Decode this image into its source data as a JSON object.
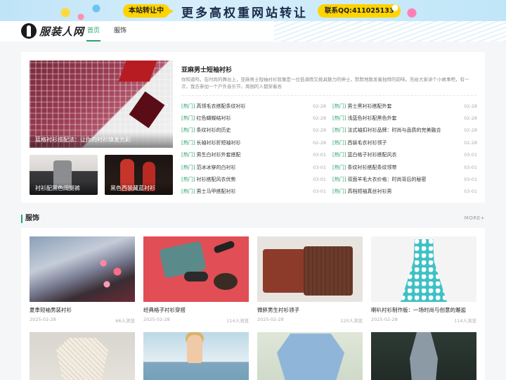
{
  "banner": {
    "tag": "本站转让中",
    "slogan": "更多高权重网站转让",
    "contact": "联系QQ:411025133"
  },
  "header": {
    "logo_text": "服装人网",
    "nav": [
      {
        "label": "首页",
        "active": true
      },
      {
        "label": "服饰",
        "active": false
      }
    ],
    "accent_color": "#2aa36b"
  },
  "feature": {
    "hero_caption": "蓝格衬衫搭配法：让你的衬衫焕发光彩",
    "thumbs": [
      {
        "caption": "衬衫配黑色阔腿裤"
      },
      {
        "caption": "黑色西装藏蓝衬衫"
      }
    ],
    "title": "亚麻男士短袖衬衫",
    "desc": "你知道吗，在时尚的舞台上，亚麻男士短袖衬衫就像是一位低调而又极具魅力的绅士，默默地散发着独特的韵味。先给大家讲个小故事吧，有一次，我去参加一个户外音乐节，周围的人都穿着各",
    "list_left": [
      {
        "tag": "[热门]",
        "title": "高领毛衣搭配条纹衬衫",
        "date": "02-28"
      },
      {
        "tag": "[热门]",
        "title": "红色蝴蝶结衬衫",
        "date": "02-28"
      },
      {
        "tag": "[热门]",
        "title": "条纹衬衫的历史",
        "date": "02-28"
      },
      {
        "tag": "[热门]",
        "title": "长袖衬衫折短袖衬衫",
        "date": "02-28"
      },
      {
        "tag": "[热门]",
        "title": "男生白衬衫外套搭配",
        "date": "03-01"
      },
      {
        "tag": "[热门]",
        "title": "范冰冰穿的白衬衫",
        "date": "03-01"
      },
      {
        "tag": "[热门]",
        "title": "衬衫搭配风衣优势",
        "date": "03-01"
      },
      {
        "tag": "[热门]",
        "title": "男士马甲搭配衬衫",
        "date": "03-01"
      }
    ],
    "list_right": [
      {
        "tag": "[热门]",
        "title": "男士黑衬衫搭配外套",
        "date": "02-28"
      },
      {
        "tag": "[热门]",
        "title": "浅蓝色衬衫配黑色外套",
        "date": "02-28"
      },
      {
        "tag": "[热门]",
        "title": "法式袖扣衬衫品牌：时尚与品质的完美融合",
        "date": "02-28"
      },
      {
        "tag": "[热门]",
        "title": "西装毛衣衬衫领子",
        "date": "02-28"
      },
      {
        "tag": "[热门]",
        "title": "蓝白格子衬衫搭配风衣",
        "date": "03-01"
      },
      {
        "tag": "[热门]",
        "title": "条纹衬衫搭配条纹领带",
        "date": "03-01"
      },
      {
        "tag": "[热门]",
        "title": "双面羊毛大衣价格：时尚背后的秘密",
        "date": "03-01"
      },
      {
        "tag": "[热门]",
        "title": "高档短袖真丝衬衫男",
        "date": "03-01"
      }
    ]
  },
  "section": {
    "title": "服饰",
    "more": "MORE+",
    "cards": [
      {
        "title": "夏季短袖男装衬衫",
        "date": "2025-02-28",
        "views": "66人浏览"
      },
      {
        "title": "经典格子衬衫穿搭",
        "date": "2025-02-28",
        "views": "114人浏览"
      },
      {
        "title": "微胖男生衬衫领子",
        "date": "2025-02-28",
        "views": "120人浏览"
      },
      {
        "title": "喇叭衬衫制作版：一场时尚与创意的邂逅",
        "date": "2025-02-28",
        "views": "114人浏览"
      }
    ]
  }
}
